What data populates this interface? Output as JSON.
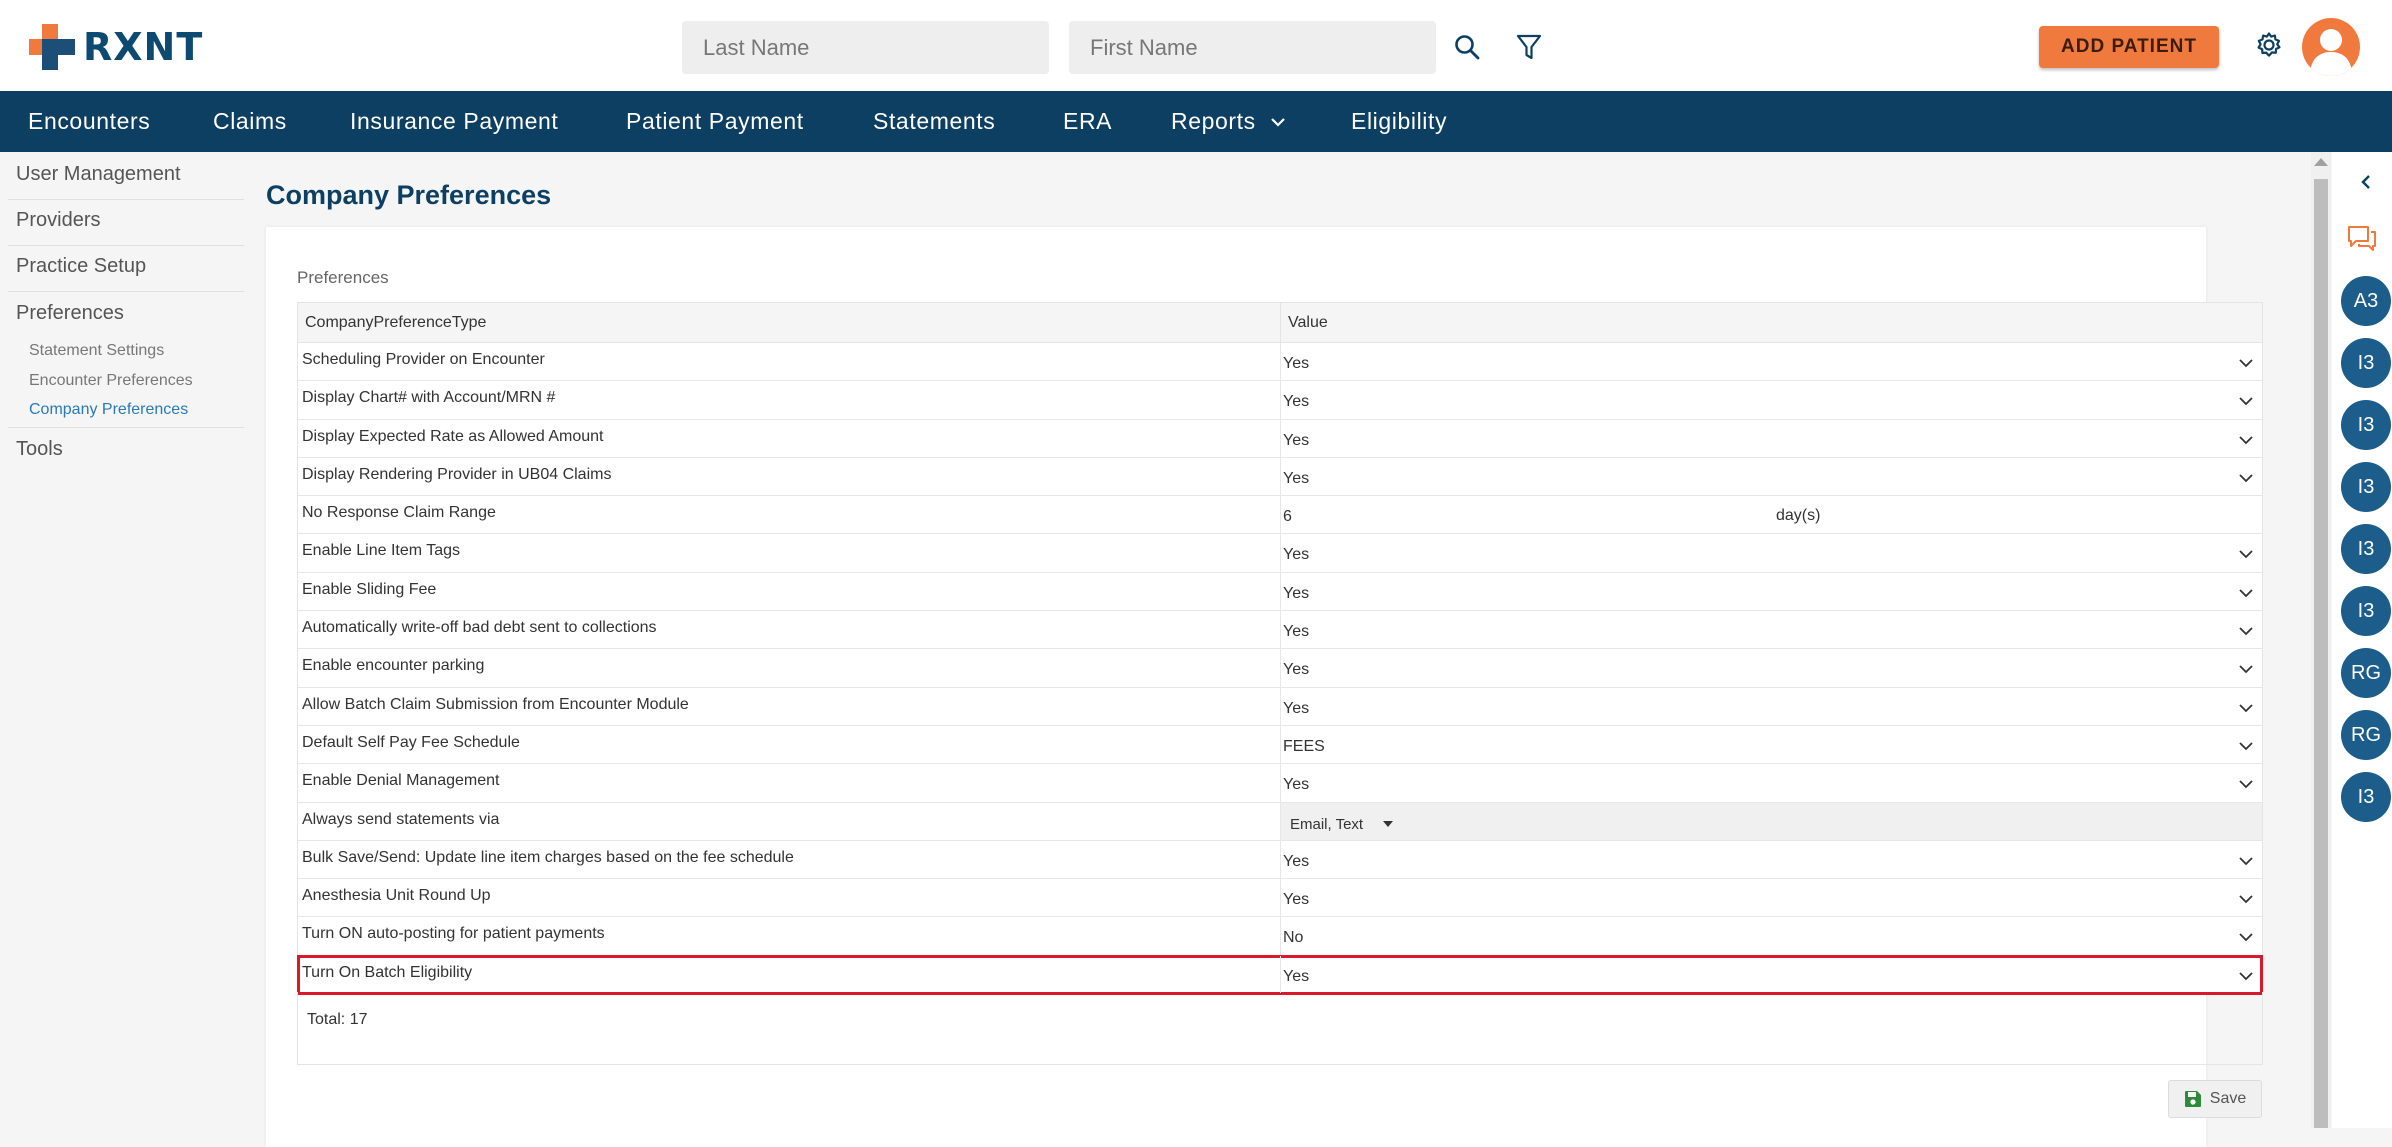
{
  "app": {
    "brand": "RXNT"
  },
  "header": {
    "last_name_placeholder": "Last Name",
    "first_name_placeholder": "First Name",
    "add_patient_label": "ADD PATIENT"
  },
  "nav": {
    "items": [
      "Encounters",
      "Claims",
      "Insurance Payment",
      "Patient Payment",
      "Statements",
      "ERA",
      "Reports",
      "Eligibility"
    ]
  },
  "sidebar": {
    "items": [
      "User Management",
      "Providers",
      "Practice Setup",
      "Preferences"
    ],
    "sub_items": [
      "Statement Settings",
      "Encounter Preferences",
      "Company Preferences"
    ],
    "tools": "Tools",
    "active_sub": "Company Preferences"
  },
  "main": {
    "title": "Company Preferences",
    "section_label": "Preferences",
    "columns": [
      "CompanyPreferenceType",
      "Value"
    ],
    "rows": [
      {
        "name": "Scheduling Provider on Encounter",
        "value": "Yes"
      },
      {
        "name": "Display Chart# with Account/MRN #",
        "value": "Yes"
      },
      {
        "name": "Display Expected Rate as Allowed Amount",
        "value": "Yes"
      },
      {
        "name": "Display Rendering Provider in UB04 Claims",
        "value": "Yes"
      },
      {
        "name": "No Response Claim Range",
        "value": "6",
        "unit": "day(s)"
      },
      {
        "name": "Enable Line Item Tags",
        "value": "Yes"
      },
      {
        "name": "Enable Sliding Fee",
        "value": "Yes"
      },
      {
        "name": "Automatically write-off bad debt sent to collections",
        "value": "Yes"
      },
      {
        "name": "Enable encounter parking",
        "value": "Yes"
      },
      {
        "name": "Allow Batch Claim Submission from Encounter Module",
        "value": "Yes"
      },
      {
        "name": "Default Self Pay Fee Schedule",
        "value": "FEES"
      },
      {
        "name": "Enable Denial Management",
        "value": "Yes"
      },
      {
        "name": "Always send statements via",
        "value": "Email,  Text"
      },
      {
        "name": "Bulk Save/Send: Update line item charges based on the fee schedule",
        "value": "Yes"
      },
      {
        "name": "Anesthesia Unit Round Up",
        "value": "Yes"
      },
      {
        "name": "Turn ON auto-posting for patient payments",
        "value": "No"
      },
      {
        "name": "Turn On Batch Eligibility",
        "value": "Yes"
      }
    ],
    "total": "Total: 17",
    "save_label": "Save"
  },
  "rail": {
    "circles": [
      "A3",
      "I3",
      "I3",
      "I3",
      "I3",
      "I3",
      "RG",
      "RG",
      "I3"
    ]
  },
  "colors": {
    "brand_navy": "#0d3f62",
    "accent_orange": "#f07a3e",
    "highlight_red": "#d9192b",
    "rail_blue": "#1c5d8c"
  }
}
